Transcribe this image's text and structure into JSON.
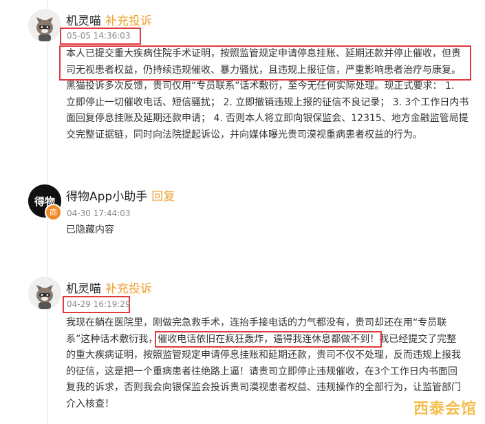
{
  "posts": [
    {
      "username": "机灵喵",
      "action": "补充投诉",
      "time": "05-05 14:36:03",
      "lines": [
        "本人已提交重大疾病住院手术证明，按照监管规定申请停息挂账、延期还款并停止催收，但贵",
        "司无视患者权益，仍持续违规催收、暴力骚扰，且违规上报征信，严重影响患者治疗与康复。",
        "黑猫投诉多次反馈，贵司仅用“专员联系”话术敷衍，至今无任何实际处理。现正式要求： 1.",
        "立即停止一切催收电话、短信骚扰； 2. 立即撤销违规上报的征信不良记录； 3. 3个工作日内书",
        "面回复停息挂账及延期还款申请； 4. 否则本人将立即向银保监会、12315、地方金融监管局提",
        "交完整证据链，同时向法院提起诉讼，并向媒体曝光贵司漠视重病患者权益的行为。"
      ]
    },
    {
      "username": "得物App小助手",
      "action": "回复",
      "time": "04-30 17:44:03",
      "avatar_text": "得物",
      "badge": "商",
      "lines": [
        "已隐藏内容"
      ]
    },
    {
      "username": "机灵喵",
      "action": "补充投诉",
      "time": "04-29 16:19:29",
      "lines_pre": "我现在躺在医院里，刚做完急救手术，连抬手接电话的力气都没有，贵司却还在用“专员联",
      "line2_a": "系”这种话术敷衍我，",
      "line2_mark": "催收电话依旧在疯狂轰炸，逼得我连休息都做不到！",
      "line2_b": "我已经提交了完整",
      "lines_post": [
        "的重大疾病证明，按照监管规定申请停息挂账和延期还款，贵司不仅不处理，反而违规上报我",
        "的征信，这是把一个重病患者往绝路上逼！请贵司立即停止违规催收，在3个工作日内书面回",
        "复我的诉求，否则我会向银保监会投诉贵司漠视患者权益、违规操作的全部行为，让监管部门",
        "介入核查！"
      ]
    }
  ],
  "watermark": "西泰会馆",
  "colors": {
    "accent": "#f0a030",
    "highlight_box": "#e0393e",
    "watermark": "#f4b73a"
  },
  "icons": [
    "cat-avatar-icon",
    "dewu-logo-icon"
  ]
}
